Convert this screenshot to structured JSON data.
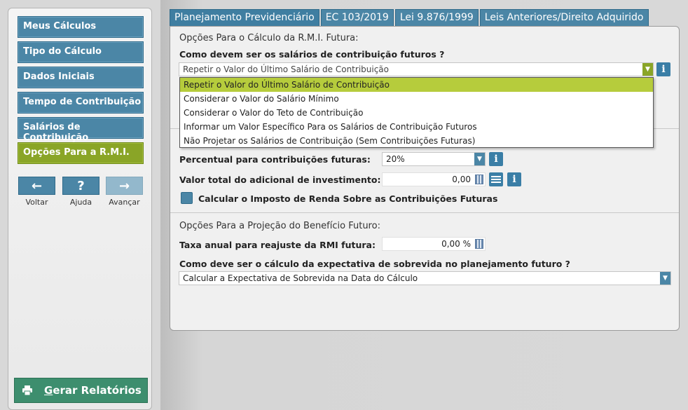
{
  "sidebar": {
    "items": [
      {
        "label": "Meus Cálculos"
      },
      {
        "label": "Tipo do Cálculo"
      },
      {
        "label": "Dados Iniciais"
      },
      {
        "label": "Tempo de Contribuição"
      },
      {
        "label": "Salários de Contribuição"
      },
      {
        "label": "Opções Para a R.M.I."
      }
    ],
    "nav": {
      "back": {
        "symbol": "←",
        "label": "Voltar"
      },
      "help": {
        "symbol": "?",
        "label": "Ajuda"
      },
      "forward": {
        "symbol": "→",
        "label": "Avançar"
      }
    },
    "report_button": "Gerar Relatórios"
  },
  "tabs": [
    {
      "label": "Planejamento Previdenciário"
    },
    {
      "label": "EC 103/2019"
    },
    {
      "label": "Lei 9.876/1999"
    },
    {
      "label": "Leis Anteriores/Direito Adquirido"
    }
  ],
  "section1": {
    "title": "Opções Para o Cálculo da R.M.I. Futura:",
    "question": "Como devem ser os salários de contribuição futuros  ?",
    "select_value": "Repetir o Valor do Último Salário de Contribuição",
    "options": [
      "Repetir o Valor do Último Salário de Contribuição",
      "Considerar o Valor do Salário Mínimo",
      "Considerar o Valor do Teto de Contribuição",
      "Informar um Valor Específico Para os Salários de Contribuição Futuros",
      "Não Projetar os Salários de Contribuição (Sem Contribuições Futuras)"
    ],
    "selected_index": 0
  },
  "section2": {
    "percent_label": "Percentual para contribuições futuras:",
    "percent_value": "20%",
    "additional_label": "Valor total do adicional de investimento:",
    "additional_value": "0,00",
    "tax_checkbox_label": "Calcular o Imposto de Renda Sobre as Contribuições Futuras"
  },
  "section3": {
    "title": "Opções Para a Projeção do Benefício Futuro:",
    "rate_label": "Taxa anual para reajuste da RMI futura:",
    "rate_value": "0,00 %",
    "survival_question": "Como deve ser o cálculo da expectativa de sobrevida no planejamento futuro ?",
    "survival_value": "Calcular a Expectativa de Sobrevida na Data do Cálculo"
  },
  "icons": {
    "info": "i",
    "printer": "printer-icon",
    "calculator": "calculator-icon",
    "list": "list-icon",
    "dropdown_arrow": "▼"
  },
  "colors": {
    "nav_blue": "#4b86a6",
    "active_green": "#8aa527",
    "selected_option": "#b6cc3c",
    "report_green": "#3d8e6e"
  }
}
